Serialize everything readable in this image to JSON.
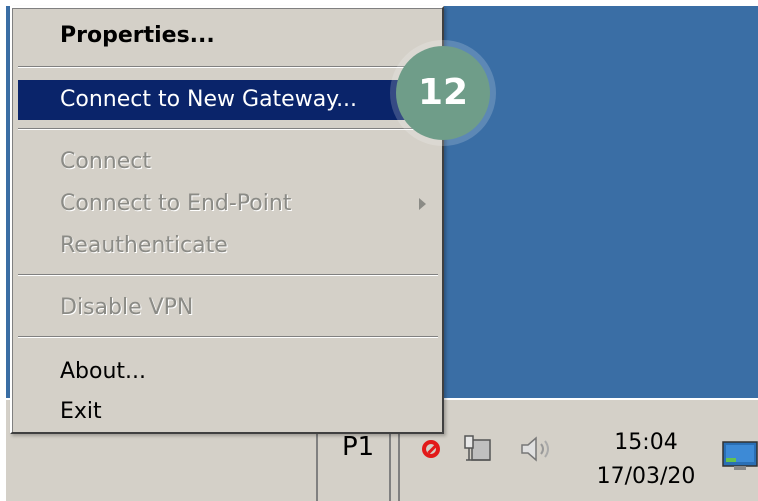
{
  "menu": {
    "properties_label": "Properties...",
    "connect_new_gateway_label": "Connect to New Gateway...",
    "connect_label": "Connect",
    "connect_end_point_label": "Connect to End-Point",
    "reauthenticate_label": "Reauthenticate",
    "disable_vpn_label": "Disable VPN",
    "about_label": "About...",
    "exit_label": "Exit"
  },
  "taskbar": {
    "task_label": "P1",
    "clock_time": "15:04",
    "clock_date": "17/03/20"
  },
  "step_badge": {
    "label": "12"
  },
  "icons": {
    "no_entry": "no-entry-icon",
    "network": "network-icon",
    "speaker": "speaker-icon",
    "monitor": "monitor-icon"
  },
  "colors": {
    "desktop": "#3a6ea5",
    "menu_bg": "#d4d0c8",
    "highlight": "#0a246a",
    "badge": "#6f9d89"
  }
}
